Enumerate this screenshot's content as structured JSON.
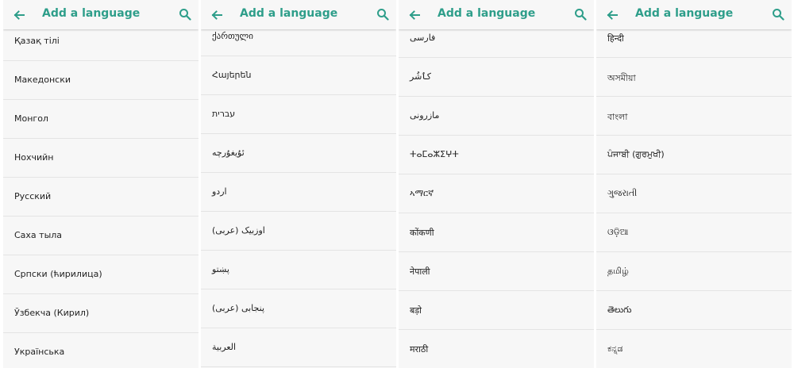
{
  "screen_title": "Add a language",
  "accent_color": "#2e9e8a",
  "icons": {
    "back": "arrow-back-icon",
    "search": "search-icon"
  },
  "panels": [
    {
      "items": [
        "Қазақ тілі",
        "Македонски",
        "Монгол",
        "Нохчийн",
        "Русский",
        "Саха тыла",
        "Српски (ћирилица)",
        "Ўзбекча (Кирил)",
        "Українська"
      ]
    },
    {
      "items": [
        "ქართული",
        "Հայերեն",
        "עברית",
        "ئۇيغۇرچە",
        "اردو",
        "اوزبیک (عربی)",
        "پښتو",
        "پنجابی (عربی)",
        "العربية"
      ]
    },
    {
      "items": [
        "فارسی",
        "کٲشُر",
        "مازرونی",
        "ⵜⴰⵎⴰⵣⵉⵖⵜ",
        "ኣማርኛ",
        "कोंकणी",
        "नेपाली",
        "बड़ो",
        "मराठी"
      ]
    },
    {
      "items": [
        "हिन्दी",
        "অসমীয়া",
        "বাংলা",
        "ਪੰਜਾਬੀ (ਗੁਰਮੁਖੀ)",
        "ગુજરાતી",
        "ଓଡ଼ିଆ",
        "தமிழ்",
        "తెలుగు",
        "ಕನ್ನಡ"
      ]
    }
  ]
}
